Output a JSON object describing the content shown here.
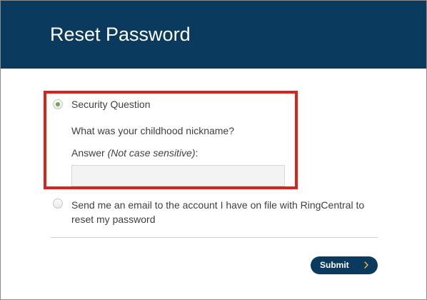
{
  "header": {
    "title": "Reset Password"
  },
  "form": {
    "security_question_label": "Security Question",
    "question_text": "What was your childhood nickname?",
    "answer_label": "Answer ",
    "answer_hint": "(Not case sensitive)",
    "answer_suffix": ":",
    "answer_value": "",
    "email_option_label": "Send me an email to the account I have on file with RingCentral to reset my password",
    "submit_label": "Submit"
  },
  "colors": {
    "header": "#0b3a5f",
    "highlight": "#d9231b",
    "radio_selected": "#6aa84f"
  },
  "state": {
    "selected_option": "Security Question"
  },
  "icons": {
    "submit": "chevron-right-icon"
  }
}
